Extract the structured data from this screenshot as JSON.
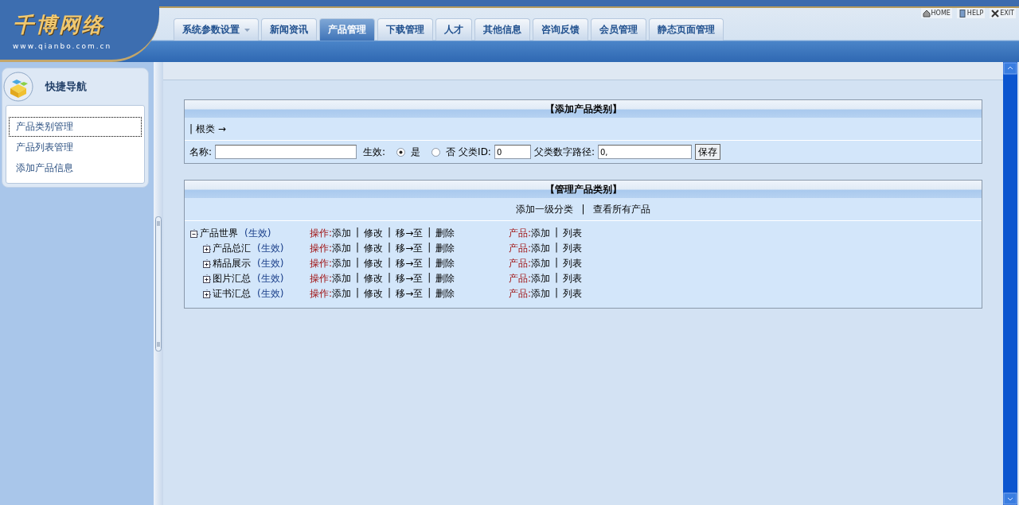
{
  "logo": {
    "title": "千博网络",
    "subtitle": "www.qianbo.com.cn"
  },
  "tabs": [
    {
      "label": "系统参数设置",
      "dropdown": true,
      "selected": false
    },
    {
      "label": "新闻资讯",
      "dropdown": false,
      "selected": false
    },
    {
      "label": "产品管理",
      "dropdown": false,
      "selected": true
    },
    {
      "label": "下载管理",
      "dropdown": false,
      "selected": false
    },
    {
      "label": "人才",
      "dropdown": false,
      "selected": false
    },
    {
      "label": "其他信息",
      "dropdown": false,
      "selected": false
    },
    {
      "label": "咨询反馈",
      "dropdown": false,
      "selected": false
    },
    {
      "label": "会员管理",
      "dropdown": false,
      "selected": false
    },
    {
      "label": "静态页面管理",
      "dropdown": false,
      "selected": false
    }
  ],
  "top_links": [
    {
      "kind": "home",
      "label": "HOME"
    },
    {
      "kind": "help",
      "label": "HELP"
    },
    {
      "kind": "exit",
      "label": "EXIT"
    }
  ],
  "sidebar": {
    "title": "快捷导航",
    "items": [
      {
        "label": "产品类别管理",
        "selected": true
      },
      {
        "label": "产品列表管理",
        "selected": false
      },
      {
        "label": "添加产品信息",
        "selected": false
      }
    ]
  },
  "add_panel": {
    "title": "【添加产品类别】",
    "breadcrumb": "| 根类 →",
    "name_label": "名称:",
    "active_label": "生效:",
    "options": [
      {
        "label": "是",
        "selected": true
      },
      {
        "label": "否",
        "selected": false
      }
    ],
    "parent_id_label": "父类ID:",
    "parent_id": "0",
    "path_label": "父类数字路径:",
    "path": "0,",
    "save": "保存"
  },
  "manage_panel": {
    "title": "【管理产品类别】",
    "separator": "|",
    "links": [
      "添加一级分类",
      "查看所有产品"
    ],
    "tree": [
      {
        "name": "产品世界",
        "status": "(生效)",
        "ops_label": "操作:",
        "ops": [
          "添加",
          "修改",
          "移→至",
          "删除"
        ],
        "product_label": "产品:",
        "product_ops": [
          "添加",
          "列表"
        ],
        "expanded": true,
        "children": [
          {
            "name": "产品总汇",
            "status": "(生效)",
            "ops_label": "操作:",
            "ops": [
              "添加",
              "修改",
              "移→至",
              "删除"
            ],
            "product_label": "产品:",
            "product_ops": [
              "添加",
              "列表"
            ],
            "expanded": false
          },
          {
            "name": "精品展示",
            "status": "(生效)",
            "ops_label": "操作:",
            "ops": [
              "添加",
              "修改",
              "移→至",
              "删除"
            ],
            "product_label": "产品:",
            "product_ops": [
              "添加",
              "列表"
            ],
            "expanded": false
          },
          {
            "name": "图片汇总",
            "status": "(生效)",
            "ops_label": "操作:",
            "ops": [
              "添加",
              "修改",
              "移→至",
              "删除"
            ],
            "product_label": "产品:",
            "product_ops": [
              "添加",
              "列表"
            ],
            "expanded": false
          },
          {
            "name": "证书汇总",
            "status": "(生效)",
            "ops_label": "操作:",
            "ops": [
              "添加",
              "修改",
              "移→至",
              "删除"
            ],
            "product_label": "产品:",
            "product_ops": [
              "添加",
              "列表"
            ],
            "expanded": false
          }
        ]
      }
    ]
  }
}
